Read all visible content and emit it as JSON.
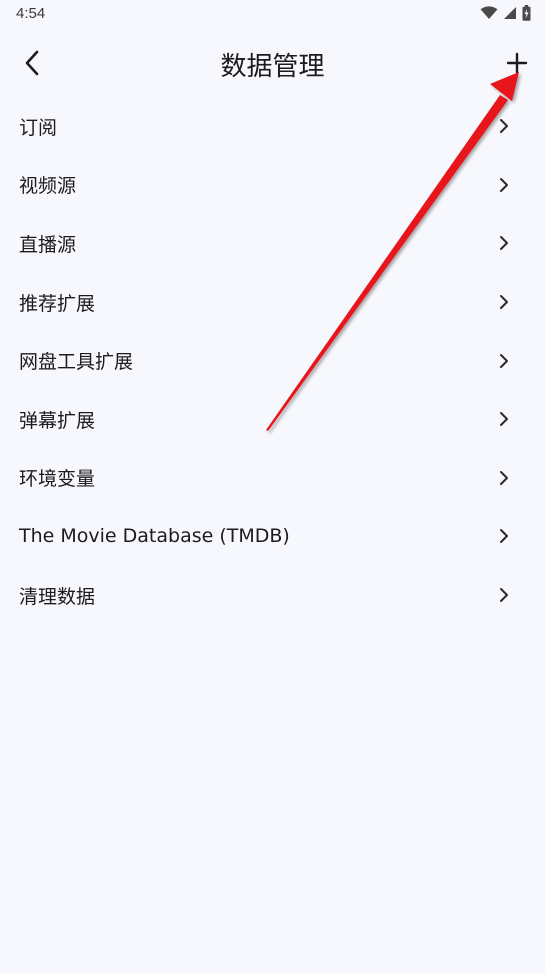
{
  "status_bar": {
    "time": "4:54"
  },
  "app_bar": {
    "title": "数据管理",
    "back_icon": "chevron-left-icon",
    "add_icon": "plus-icon"
  },
  "menu": {
    "items": [
      {
        "label": "订阅"
      },
      {
        "label": "视频源"
      },
      {
        "label": "直播源"
      },
      {
        "label": "推荐扩展"
      },
      {
        "label": "网盘工具扩展"
      },
      {
        "label": "弹幕扩展"
      },
      {
        "label": "环境变量"
      },
      {
        "label": "The Movie Database (TMDB)"
      },
      {
        "label": "清理数据"
      }
    ]
  },
  "colors": {
    "background": "#f7f8fd",
    "text": "#1c1b1f",
    "annotation_arrow": "#e8141b"
  }
}
